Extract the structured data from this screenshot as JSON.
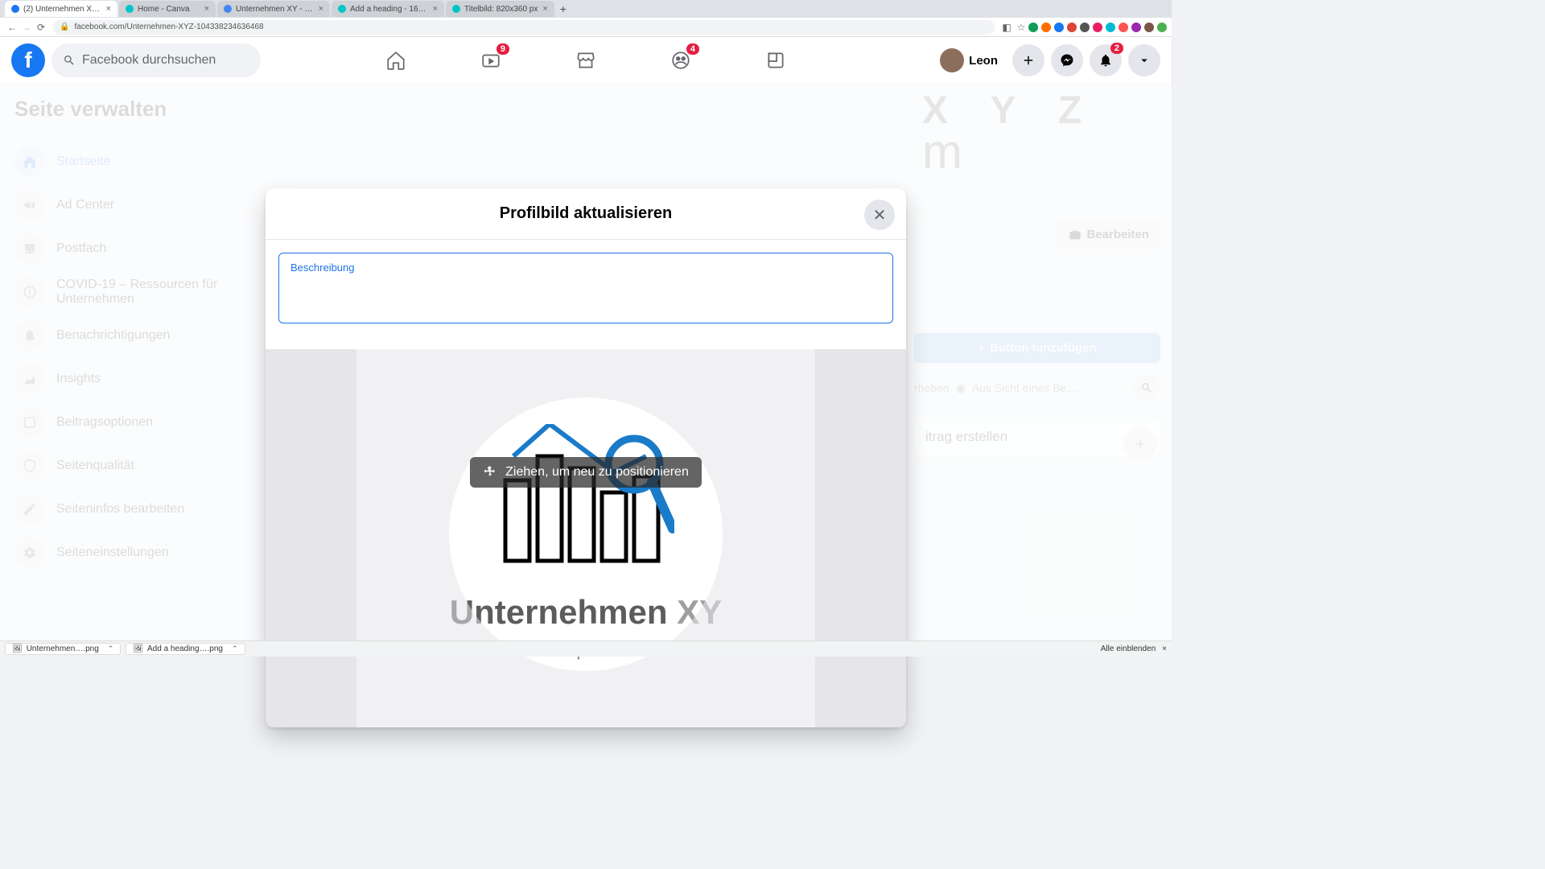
{
  "browser": {
    "tabs": [
      {
        "title": "(2) Unternehmen XYZ | Faceb…",
        "fav": "#1877f2"
      },
      {
        "title": "Home - Canva",
        "fav": "#00c4cc"
      },
      {
        "title": "Unternehmen XY - Logo",
        "fav": "#4285f4"
      },
      {
        "title": "Add a heading - 16in × 9in",
        "fav": "#00c4cc"
      },
      {
        "title": "Titelbild: 820x360 px",
        "fav": "#00c4cc"
      }
    ],
    "url": "facebook.com/Unternehmen-XYZ-104338234636468"
  },
  "top": {
    "search_placeholder": "Facebook durchsuchen",
    "nav_badges": {
      "watch": "9",
      "groups": "4"
    },
    "profile_name": "Leon",
    "notif_badge": "2"
  },
  "sidebar": {
    "title": "Seite verwalten",
    "items": [
      {
        "label": "Startseite",
        "icon": "home",
        "active": true
      },
      {
        "label": "Ad Center",
        "icon": "megaphone"
      },
      {
        "label": "Postfach",
        "icon": "inbox"
      },
      {
        "label": "COVID-19 – Ressourcen für Unternehmen",
        "icon": "info"
      },
      {
        "label": "Benachrichtigungen",
        "icon": "bell"
      },
      {
        "label": "Insights",
        "icon": "chart"
      },
      {
        "label": "Beitragsoptionen",
        "icon": "posts"
      },
      {
        "label": "Seitenqualität",
        "icon": "shield"
      },
      {
        "label": "Seiteninfos bearbeiten",
        "icon": "pencil"
      },
      {
        "label": "Seiteneinstellungen",
        "icon": "gear"
      }
    ]
  },
  "peek": {
    "xyz": "X Y Z",
    "edit": "Bearbeiten",
    "add_button": "Button hinzufügen",
    "promote": "rheben",
    "view_as": "Aus Sicht eines Be…",
    "create_post": "itrag erstellen"
  },
  "modal": {
    "title": "Profilbild aktualisieren",
    "desc_label": "Beschreibung",
    "drag_hint": "Ziehen, um neu zu positionieren",
    "logo_text_a": "Unternehmen ",
    "logo_text_b": "XY",
    "logo_url": "example.com"
  },
  "downloads": {
    "file1": "Unternehmen….png",
    "file2": "Add a heading….png",
    "show_all": "Alle einblenden"
  }
}
